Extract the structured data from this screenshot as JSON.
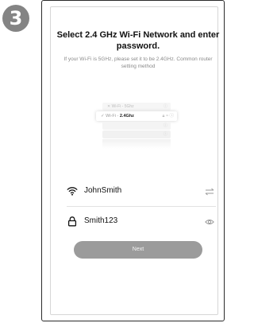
{
  "step_number": "3",
  "title": "Select 2.4 GHz Wi-Fi Network and enter password.",
  "subtitle": "If your Wi-Fi is 5GHz, please set it to be 2.4GHz. Common router setting method",
  "illustration": {
    "row1_text": "Wi-Fi - 5Ghz",
    "row2_prefix": "Wi-Fi - ",
    "row2_band": "2.4Ghz"
  },
  "network_field": {
    "icon": "wifi-icon",
    "value": "JohnSmith",
    "action_icon": "switch-arrows-icon"
  },
  "password_field": {
    "icon": "lock-icon",
    "value": "Smith123",
    "action_icon": "eye-icon"
  },
  "next_button": {
    "label": "Next"
  },
  "colors": {
    "badge": "#848484",
    "button": "#9b9b9b",
    "frame": "#2a2a2a"
  }
}
